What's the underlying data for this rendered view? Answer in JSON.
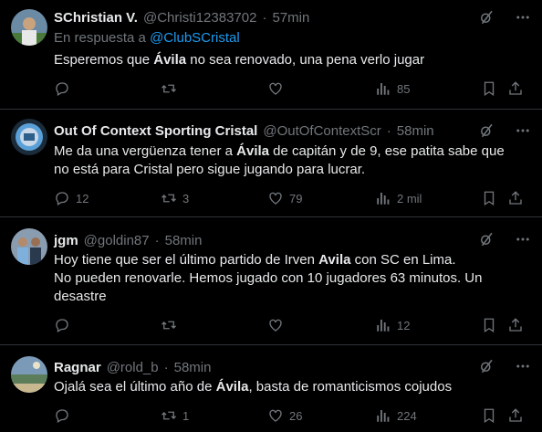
{
  "tweets": [
    {
      "name": "SChristian V.",
      "handle": "@Christi12383702",
      "time": "57min",
      "reply_prefix": "En respuesta a",
      "reply_to": "@ClubSCristal",
      "text_before": "Esperemos que ",
      "highlight": "Ávila",
      "text_after": " no sea renovado, una pena verlo jugar",
      "replies": "",
      "retweets": "",
      "likes": "",
      "views": "85"
    },
    {
      "name": "Out Of Context Sporting Cristal",
      "handle": "@OutOfContextScr",
      "time": "58min",
      "line1_before": "Me da una vergüenza tener a ",
      "highlight": "Ávila",
      "line1_after": " de capitán y de 9,  ese patita sabe que",
      "line2": "no está para Cristal pero sigue jugando para lucrar.",
      "replies": "12",
      "retweets": "3",
      "likes": "79",
      "views": "2 mil"
    },
    {
      "name": "jgm",
      "handle": "@goldin87",
      "time": "58min",
      "line1_before": "Hoy tiene que ser el último partido de Irven ",
      "highlight": "Avila",
      "line1_after": " con SC en Lima.",
      "line2": "No pueden renovarle. Hemos jugado con 10 jugadores 63 minutos. Un",
      "line3": "desastre",
      "replies": "",
      "retweets": "",
      "likes": "",
      "views": "12"
    },
    {
      "name": "Ragnar",
      "handle": "@rold_b",
      "time": "58min",
      "text_before": "Ojalá sea el último año de ",
      "highlight": "Ávila",
      "text_after": ", basta de romanticismos cojudos",
      "replies": "",
      "retweets": "1",
      "likes": "26",
      "views": "224"
    }
  ],
  "separator": "·",
  "colors": {
    "link": "#1d9bf0",
    "muted": "#71767b",
    "text": "#e7e9ea",
    "divider": "#2f3336"
  },
  "icons": [
    "reply-icon",
    "retweet-icon",
    "like-icon",
    "views-icon",
    "bookmark-icon",
    "share-icon",
    "grok-icon",
    "more-icon"
  ]
}
